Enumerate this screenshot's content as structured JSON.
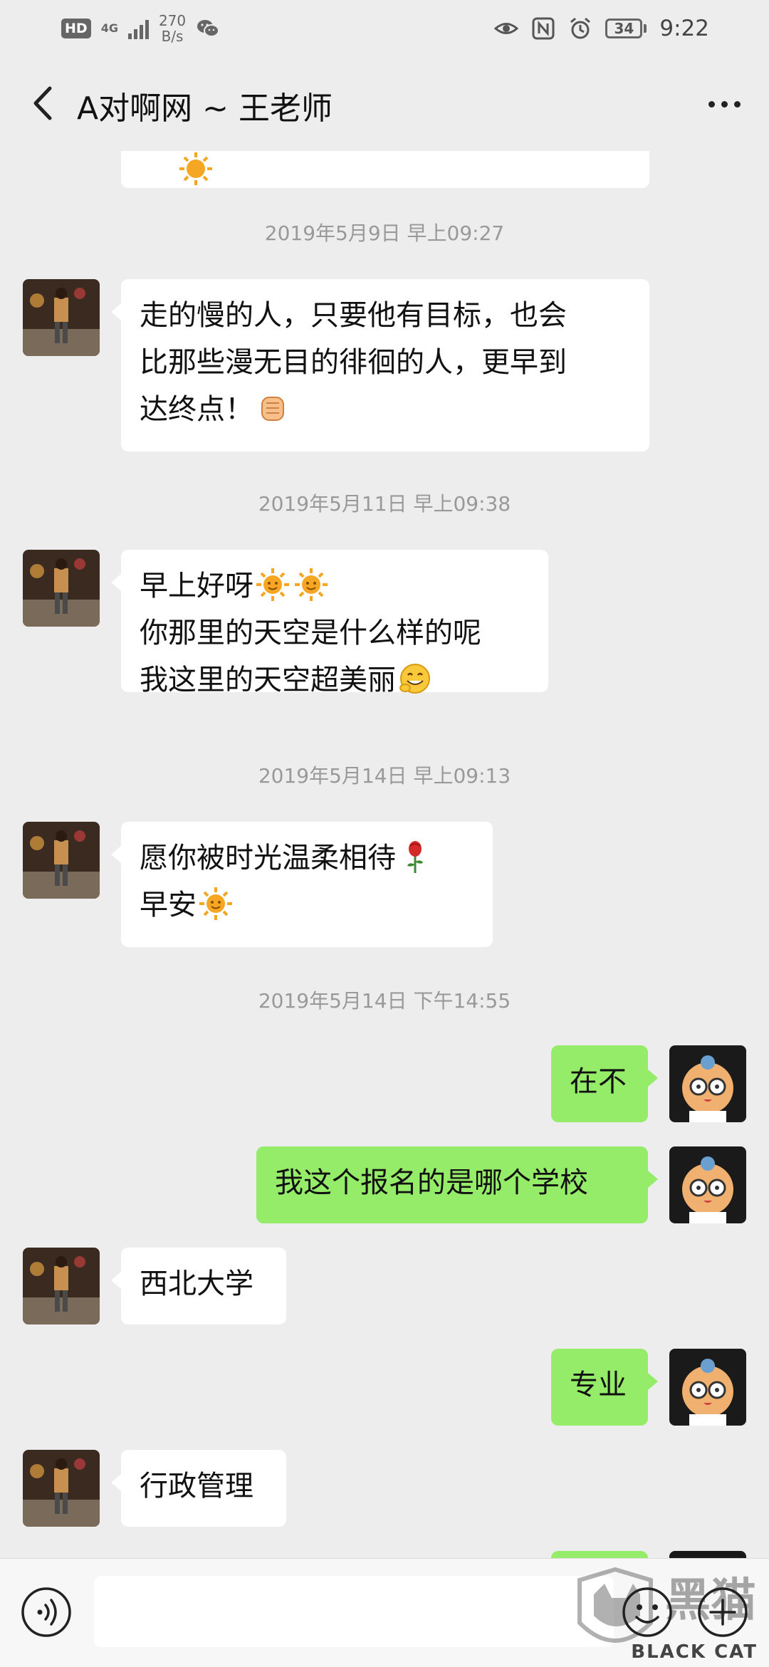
{
  "status_bar": {
    "hd": "HD",
    "network": "4G",
    "speed_value": "270",
    "speed_unit": "B/s",
    "battery": "34",
    "time": "9:22",
    "icons": [
      "wechat-icon",
      "eye-icon",
      "nfc-icon",
      "alarm-icon",
      "battery-icon"
    ]
  },
  "header": {
    "title": "A对啊网 ~ 王老师",
    "back_icon": "chevron-left-icon",
    "more_icon": "more-dots-icon"
  },
  "messages": [
    {
      "type": "time",
      "text": "2019年5月9日 早上09:27"
    },
    {
      "type": "in",
      "lines": [
        "走的慢的人，只要他有目标，也会",
        "比那些漫无目的徘徊的人，更早到",
        "达终点！"
      ],
      "emoji": [
        "fist-emoji"
      ]
    },
    {
      "type": "time",
      "text": "2019年5月11日 早上09:38"
    },
    {
      "type": "in",
      "lines": [
        "早上好呀",
        "你那里的天空是什么样的呢",
        "我这里的天空超美丽"
      ],
      "emoji": [
        "sun-emoji",
        "sun-emoji",
        "grin-emoji"
      ]
    },
    {
      "type": "time",
      "text": "2019年5月14日 早上09:13"
    },
    {
      "type": "in",
      "lines": [
        "愿你被时光温柔相待",
        "早安"
      ],
      "emoji": [
        "rose-emoji",
        "sun-emoji"
      ]
    },
    {
      "type": "time",
      "text": "2019年5月14日 下午14:55"
    },
    {
      "type": "out",
      "text": "在不"
    },
    {
      "type": "out",
      "text": "我这个报名的是哪个学校"
    },
    {
      "type": "in",
      "text": "西北大学"
    },
    {
      "type": "out",
      "text": "专业"
    },
    {
      "type": "in",
      "text": "行政管理"
    }
  ],
  "input_bar": {
    "voice_icon": "voice-icon",
    "input_value": "",
    "emoji_icon": "smiley-icon",
    "plus_icon": "plus-icon",
    "watermark_text": "BLACK CAT"
  },
  "colors": {
    "background": "#ededed",
    "bubble_in": "#ffffff",
    "bubble_out": "#95ec69",
    "timestamp": "#999999"
  }
}
